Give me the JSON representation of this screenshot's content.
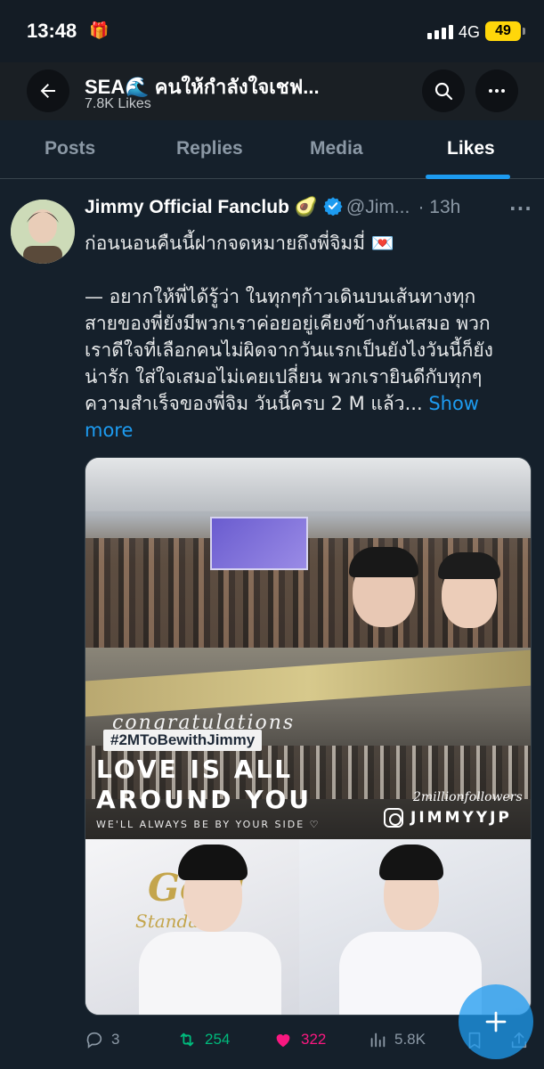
{
  "status_bar": {
    "time": "13:48",
    "network": "4G",
    "battery": "49"
  },
  "header": {
    "name": "SEA🌊 คนให้กำลังใจเชฟ...",
    "likes_count": "7.8K Likes"
  },
  "tabs": [
    {
      "label": "Posts",
      "active": false
    },
    {
      "label": "Replies",
      "active": false
    },
    {
      "label": "Media",
      "active": false
    },
    {
      "label": "Likes",
      "active": true
    }
  ],
  "tweet": {
    "author": "Jimmy Official Fanclub 🥑",
    "handle": "@Jim...",
    "time": "· 13h",
    "lines": [
      "ก่อนนอนคืนนี้ฝากจดหมายถึงพี่จิมมี่ 💌",
      "",
      "— อยากให้พี่ได้รู้ว่า ในทุกๆก้าวเดินบนเส้นทางทุก",
      "สายของพี่ยังมีพวกเราค่อยอยู่เคียงข้างกันเสมอ พวก",
      "เราดีใจที่เลือกคนไม่ผิดจากวันแรกเป็นยังไงวันนี้ก็ยัง",
      "น่ารัก ใส่ใจเสมอไม่เคยเปลี่ยน  พวกเรายินดีกับทุกๆ",
      "ความสำเร็จของพี่จิม วันนี้ครบ 2 M แล้ว..."
    ],
    "show_more_a": "Show",
    "show_more_b": "more",
    "media": {
      "congrats": "congratulations",
      "hashtag": "#2MToBewithJimmy",
      "love_line1": "LOVE IS ALL",
      "love_line2": "AROUND YOU",
      "side_line": "WE'LL ALWAYS BE BY YOUR SIDE ♡",
      "followers_text": "2millionfollowers",
      "ig_handle": "JIMMYYJP",
      "gold_text": "Gold",
      "stand_text": "Standard"
    },
    "stats": {
      "replies": "3",
      "retweets": "254",
      "likes": "322",
      "views": "5.8K"
    }
  },
  "colors": {
    "accent": "#1d9bf0",
    "retweet": "#00ba7c",
    "like": "#f91880",
    "background": "#15202b"
  },
  "icons": [
    "back-arrow-icon",
    "search-icon",
    "more-icon",
    "verified-badge-icon",
    "reply-icon",
    "retweet-icon",
    "heart-icon",
    "views-icon",
    "bookmark-icon",
    "share-icon",
    "plus-icon"
  ]
}
